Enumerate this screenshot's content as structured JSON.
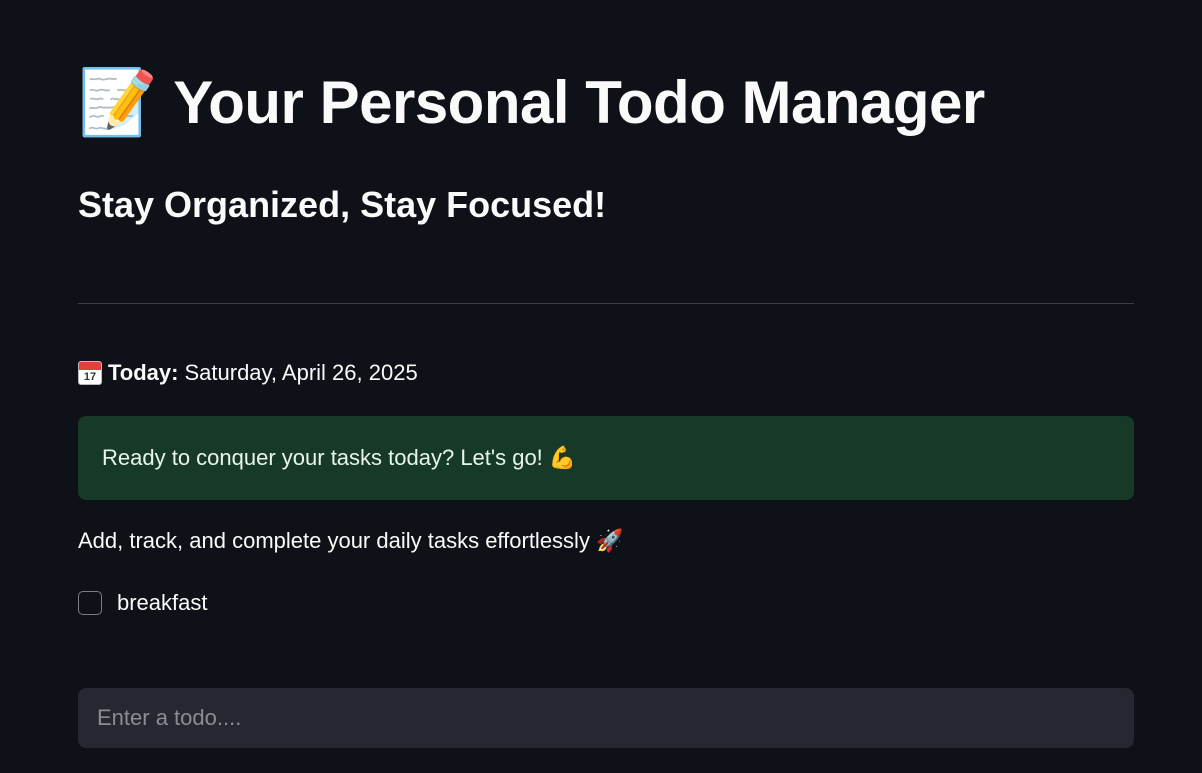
{
  "header": {
    "title_emoji": "📝",
    "title": "Your Personal Todo Manager",
    "subtitle": "Stay Organized, Stay Focused!"
  },
  "date": {
    "label": "Today:",
    "value": "Saturday, April 26, 2025"
  },
  "alert": {
    "message": "Ready to conquer your tasks today? Let's go! 💪",
    "color": "#173928"
  },
  "tagline": "Add, track, and complete your daily tasks effortlessly 🚀",
  "todos": [
    {
      "label": "breakfast",
      "checked": false
    }
  ],
  "input": {
    "placeholder": "Enter a todo....",
    "value": ""
  },
  "colors": {
    "background": "#0e1117",
    "input_background": "#262730",
    "text": "#fafafa"
  }
}
